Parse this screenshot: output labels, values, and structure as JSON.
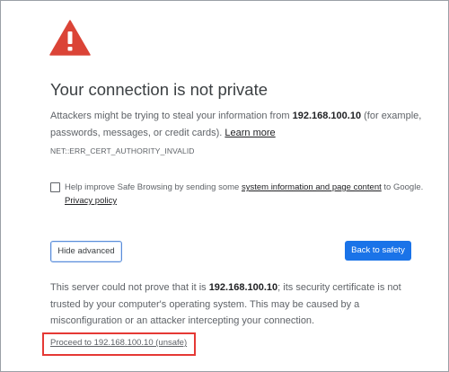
{
  "colors": {
    "warning_red": "#db4437",
    "primary_blue": "#1a73e8",
    "highlight_red": "#e53935"
  },
  "warning": {
    "icon": "warning-triangle-icon",
    "title": "Your connection is not private",
    "desc_before": "Attackers might be trying to steal your information from ",
    "host": "192.168.100.10",
    "desc_after": " (for example, passwords, messages, or credit cards). ",
    "learn_more": "Learn more",
    "error_code": "NET::ERR_CERT_AUTHORITY_INVALID"
  },
  "safe_browsing": {
    "checked": false,
    "text_before": "Help improve Safe Browsing by sending some ",
    "info_link": "system information and page content",
    "text_after": " to Google.",
    "privacy_link": "Privacy policy"
  },
  "buttons": {
    "hide_advanced": "Hide advanced",
    "back_to_safety": "Back to safety"
  },
  "details": {
    "text_before": "This server could not prove that it is ",
    "host": "192.168.100.10",
    "text_after": "; its security certificate is not trusted by your computer's operating system. This may be caused by a misconfiguration or an attacker intercepting your connection.",
    "proceed_link": "Proceed to 192.168.100.10 (unsafe)"
  }
}
